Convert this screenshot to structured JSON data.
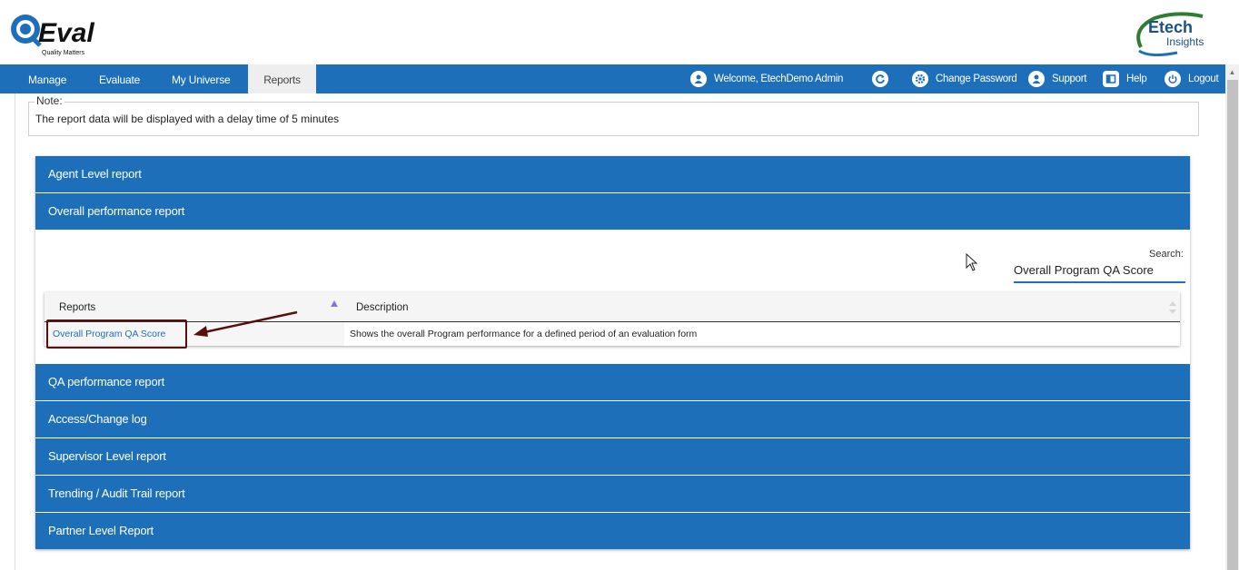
{
  "logo": {
    "left_text": "QEval",
    "left_tagline": "Quality Matters",
    "right_text_1": "Etech",
    "right_text_2": "Insights"
  },
  "nav": {
    "tabs": [
      "Manage",
      "Evaluate",
      "My Universe",
      "Reports"
    ],
    "active_tab": "Reports",
    "welcome": "Welcome, EtechDemo Admin",
    "change_password": "Change Password",
    "support": "Support",
    "help": "Help",
    "logout": "Logout"
  },
  "note": {
    "legend": "Note:",
    "text": "The report data will be displayed with a delay time of 5 minutes"
  },
  "sections": [
    "Agent Level report",
    "Overall performance report",
    "QA performance report",
    "Access/Change log",
    "Supervisor Level report",
    "Trending / Audit Trail report",
    "Partner Level Report"
  ],
  "expanded_section": "Overall performance report",
  "search": {
    "label": "Search:",
    "value": "Overall Program QA Score"
  },
  "table": {
    "headers": [
      "Reports",
      "Description"
    ],
    "rows": [
      {
        "report": "Overall Program QA Score",
        "description": "Shows the overall Program performance for a defined period of an evaluation form"
      }
    ]
  },
  "colors": {
    "accent": "#1d6fba",
    "highlight_border": "#5a0f0f"
  }
}
